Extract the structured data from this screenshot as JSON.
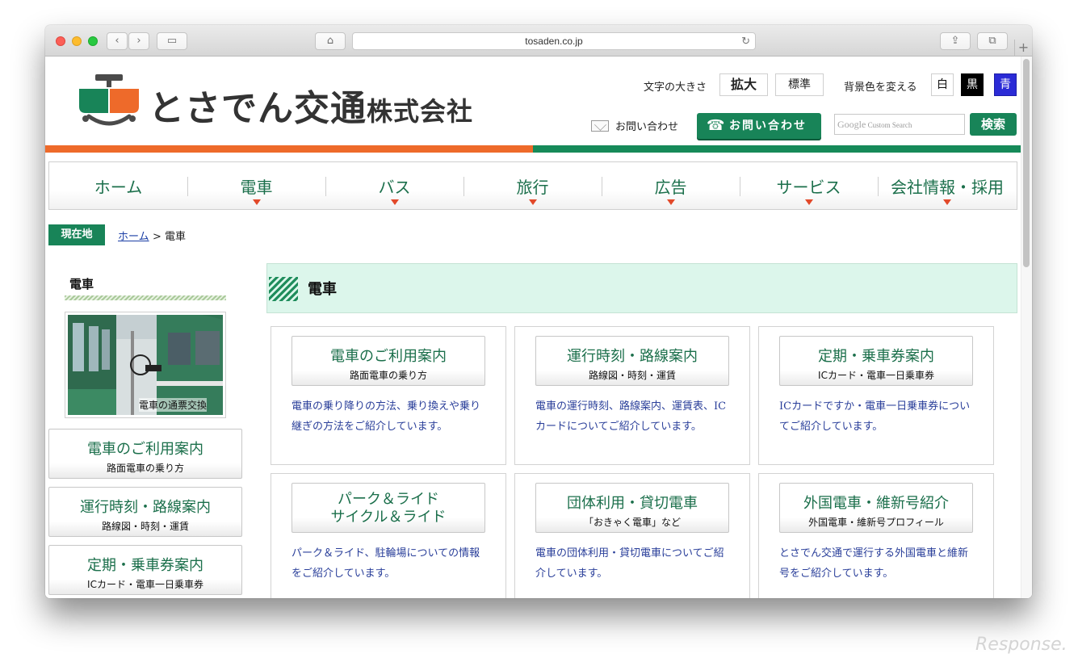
{
  "browser": {
    "url": "tosaden.co.jp"
  },
  "header": {
    "logo_text_main": "とさでん交通",
    "logo_text_suffix": "株式会社",
    "font_size_label": "文字の大きさ",
    "font_size_large": "拡大",
    "font_size_normal": "標準",
    "bg_color_label": "背景色を変える",
    "bg_white": "白",
    "bg_black": "黒",
    "bg_blue": "青",
    "contact_link": "お問い合わせ",
    "contact_button": "お問い合わせ",
    "search_placeholder_brand": "Google",
    "search_placeholder": "Custom Search",
    "search_button": "検索"
  },
  "colors": {
    "brand_green": "#188458",
    "brand_orange": "#ee6a2a",
    "nav_text": "#1b6f4b",
    "link_blue": "#2a3f9a",
    "bg_blue_button": "#2b2bd6"
  },
  "nav": {
    "items": [
      {
        "label": "ホーム"
      },
      {
        "label": "電車"
      },
      {
        "label": "バス"
      },
      {
        "label": "旅行"
      },
      {
        "label": "広告"
      },
      {
        "label": "サービス"
      },
      {
        "label": "会社情報・採用"
      }
    ]
  },
  "breadcrumb": {
    "badge": "現在地",
    "home": "ホーム",
    "separator_current": "> 電車"
  },
  "sidebar": {
    "title": "電車",
    "photo_caption": "電車の通票交換",
    "items": [
      {
        "title": "電車のご利用案内",
        "sub": "路面電車の乗り方"
      },
      {
        "title": "運行時刻・路線案内",
        "sub": "路線図・時刻・運賃"
      },
      {
        "title": "定期・乗車券案内",
        "sub": "ICカード・電車一日乗車券"
      }
    ]
  },
  "main": {
    "title": "電車",
    "cards": [
      {
        "title": "電車のご利用案内",
        "sub": "路面電車の乗り方",
        "desc": "電車の乗り降りの方法、乗り換えや乗り継ぎの方法をご紹介しています。"
      },
      {
        "title": "運行時刻・路線案内",
        "sub": "路線図・時刻・運賃",
        "desc": "電車の運行時刻、路線案内、運賃表、ICカードについてご紹介しています。"
      },
      {
        "title": "定期・乗車券案内",
        "sub": "ICカード・電車一日乗車券",
        "desc": "ICカードですか・電車一日乗車券についてご紹介しています。"
      },
      {
        "title_line1": "パーク＆ライド",
        "title_line2": "サイクル＆ライド",
        "desc": "パーク＆ライド、駐輪場についての情報をご紹介しています。"
      },
      {
        "title": "団体利用・貸切電車",
        "sub": "「おきゃく電車」など",
        "desc": "電車の団体利用・貸切電車についてご紹介しています。"
      },
      {
        "title": "外国電車・維新号紹介",
        "sub": "外国電車・維新号プロフィール",
        "desc": "とさでん交通で運行する外国電車と維新号をご紹介しています。"
      }
    ]
  },
  "watermark": "Response."
}
